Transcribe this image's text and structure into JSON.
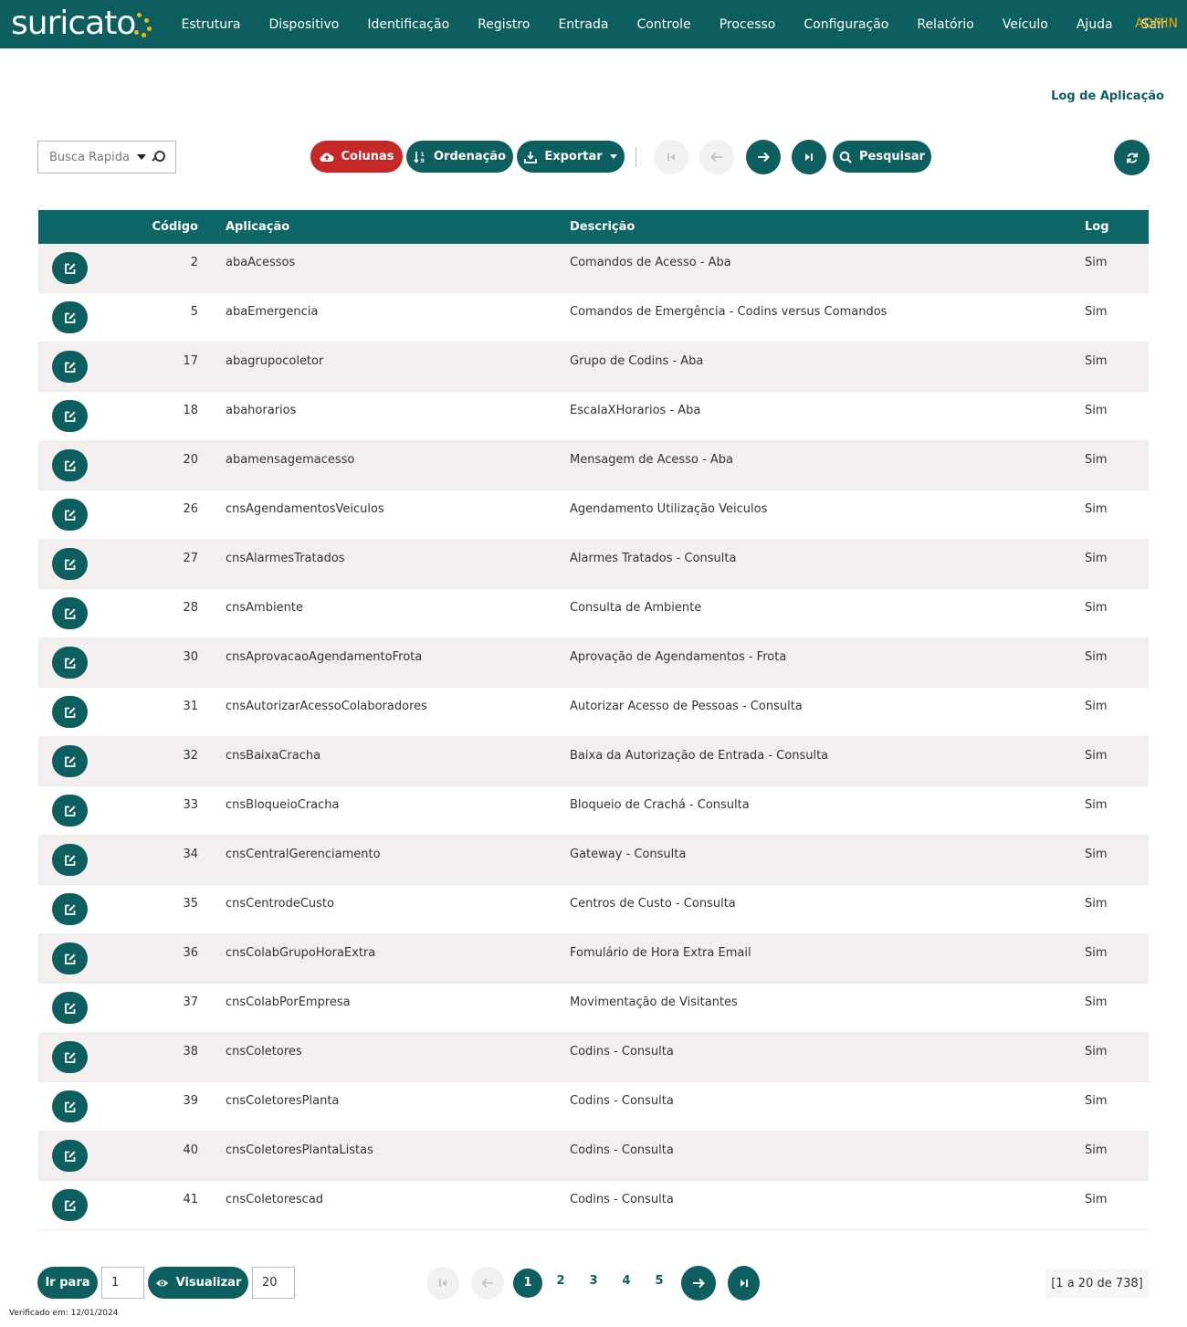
{
  "app": {
    "logo": "suricato",
    "menu": [
      "Estrutura",
      "Dispositivo",
      "Identificação",
      "Registro",
      "Entrada",
      "Controle",
      "Processo",
      "Configuração",
      "Relatório",
      "Veículo",
      "Ajuda",
      "Sair"
    ],
    "user": "ADMIN",
    "brand_color": "#0d5e5e",
    "accent_color": "#f5a700"
  },
  "page": {
    "title": "Log de Aplicação"
  },
  "toolbar": {
    "search_placeholder": "Busca Rapida",
    "columns_label": "Colunas",
    "sort_label": "Ordenação",
    "export_label": "Exportar",
    "search_label": "Pesquisar"
  },
  "table": {
    "headers": {
      "code": "Código",
      "app": "Aplicação",
      "desc": "Descrição",
      "log": "Log"
    },
    "rows": [
      {
        "code": "2",
        "app": "abaAcessos",
        "desc": "Comandos de Acesso - Aba",
        "log": "Sim"
      },
      {
        "code": "5",
        "app": "abaEmergencia",
        "desc": "Comandos de Emergência - Codins versus Comandos",
        "log": "Sim"
      },
      {
        "code": "17",
        "app": "abagrupocoletor",
        "desc": "Grupo de Codins - Aba",
        "log": "Sim"
      },
      {
        "code": "18",
        "app": "abahorarios",
        "desc": "EscalaXHorarios - Aba",
        "log": "Sim"
      },
      {
        "code": "20",
        "app": "abamensagemacesso",
        "desc": "Mensagem de Acesso - Aba",
        "log": "Sim"
      },
      {
        "code": "26",
        "app": "cnsAgendamentosVeiculos",
        "desc": "Agendamento Utilização Veiculos",
        "log": "Sim"
      },
      {
        "code": "27",
        "app": "cnsAlarmesTratados",
        "desc": "Alarmes Tratados - Consulta",
        "log": "Sim"
      },
      {
        "code": "28",
        "app": "cnsAmbiente",
        "desc": "Consulta de Ambiente",
        "log": "Sim"
      },
      {
        "code": "30",
        "app": "cnsAprovacaoAgendamentoFrota",
        "desc": "Aprovação de Agendamentos - Frota",
        "log": "Sim"
      },
      {
        "code": "31",
        "app": "cnsAutorizarAcessoColaboradores",
        "desc": "Autorizar Acesso de Pessoas - Consulta",
        "log": "Sim"
      },
      {
        "code": "32",
        "app": "cnsBaixaCracha",
        "desc": "Baixa da Autorização de Entrada - Consulta",
        "log": "Sim"
      },
      {
        "code": "33",
        "app": "cnsBloqueioCracha",
        "desc": "Bloqueio de Crachá - Consulta",
        "log": "Sim"
      },
      {
        "code": "34",
        "app": "cnsCentralGerenciamento",
        "desc": "Gateway - Consulta",
        "log": "Sim"
      },
      {
        "code": "35",
        "app": "cnsCentrodeCusto",
        "desc": "Centros de Custo - Consulta",
        "log": "Sim"
      },
      {
        "code": "36",
        "app": "cnsColabGrupoHoraExtra",
        "desc": "Fomulário de Hora Extra Email",
        "log": "Sim"
      },
      {
        "code": "37",
        "app": "cnsColabPorEmpresa",
        "desc": "Movimentação de Visitantes",
        "log": "Sim"
      },
      {
        "code": "38",
        "app": "cnsColetores",
        "desc": "Codins - Consulta",
        "log": "Sim"
      },
      {
        "code": "39",
        "app": "cnsColetoresPlanta",
        "desc": "Codins - Consulta",
        "log": "Sim"
      },
      {
        "code": "40",
        "app": "cnsColetoresPlantaListas",
        "desc": "Codins - Consulta",
        "log": "Sim"
      },
      {
        "code": "41",
        "app": "cnsColetorescad",
        "desc": "Codins - Consulta",
        "log": "Sim"
      }
    ]
  },
  "footer": {
    "goto_label": "Ir para",
    "goto_value": "1",
    "view_label": "Visualizar",
    "view_value": "20",
    "pages": [
      "1",
      "2",
      "3",
      "4",
      "5"
    ],
    "current_page": "1",
    "range_info": "[1 a 20 de 738]",
    "verified": "Verificado em: 12/01/2024"
  }
}
